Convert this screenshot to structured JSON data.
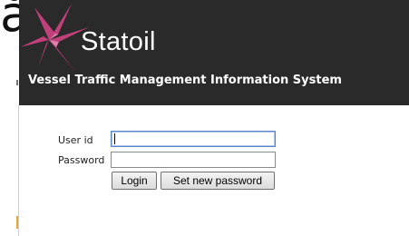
{
  "corner_glyph": "å",
  "header": {
    "brand": "Statoil",
    "system_title": "Vessel Traffic Management Information System",
    "logo_icon": "statoil-star-logo-icon",
    "colors": {
      "background": "#2a2a2a",
      "logo": "#c0407a"
    }
  },
  "login": {
    "userid_label": "User id",
    "password_label": "Password",
    "userid_value": "",
    "password_value": "",
    "login_button": "Login",
    "set_password_button": "Set new password"
  }
}
